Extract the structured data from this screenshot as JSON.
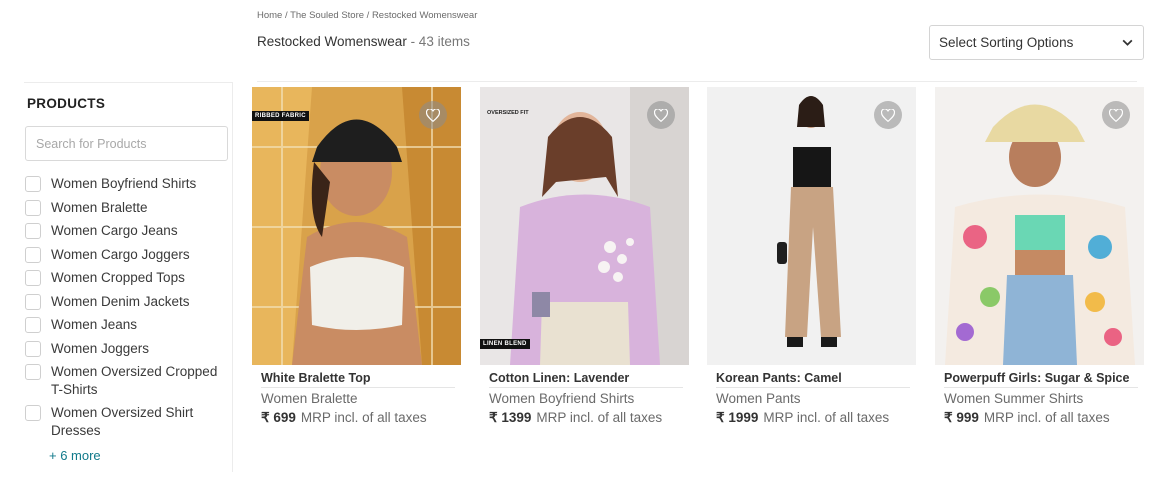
{
  "breadcrumb": "Home / The Souled Store / Restocked Womenswear",
  "page": {
    "title": "Restocked Womenswear",
    "count": " - 43 items"
  },
  "sort": {
    "label": "Select Sorting Options",
    "icon": "chevron-down-icon"
  },
  "sidebar": {
    "title": "PRODUCTS",
    "search_placeholder": "Search for Products",
    "filters": [
      "Women Boyfriend Shirts",
      "Women Bralette",
      "Women Cargo Jeans",
      "Women Cargo Joggers",
      "Women Cropped Tops",
      "Women Denim Jackets",
      "Women Jeans",
      "Women Joggers",
      "Women Oversized Cropped T-Shirts",
      "Women Oversized Shirt Dresses"
    ],
    "more": "+ 6 more"
  },
  "products": [
    {
      "name": "White Bralette Top",
      "category": "Women Bralette",
      "price": "₹ 699",
      "mrp": "MRP incl. of all taxes",
      "tag": "RIBBED FABRIC",
      "icon": "heart-icon"
    },
    {
      "name": "Cotton Linen: Lavender",
      "category": "Women Boyfriend Shirts",
      "price": "₹ 1399",
      "mrp": "MRP incl. of all taxes",
      "tag_top": "OVERSIZED FIT",
      "tag_bottom": "LINEN BLEND",
      "icon": "heart-icon"
    },
    {
      "name": "Korean Pants: Camel",
      "category": "Women Pants",
      "price": "₹ 1999",
      "mrp": "MRP incl. of all taxes",
      "icon": "heart-icon"
    },
    {
      "name": "Powerpuff Girls: Sugar & Spice",
      "category": "Women Summer Shirts",
      "price": "₹ 999",
      "mrp": "MRP incl. of all taxes",
      "icon": "heart-icon"
    }
  ],
  "colors": {
    "accent": "#117a8b",
    "text": "#333333",
    "muted": "#6a6a6a",
    "border": "#d9d9d9"
  }
}
